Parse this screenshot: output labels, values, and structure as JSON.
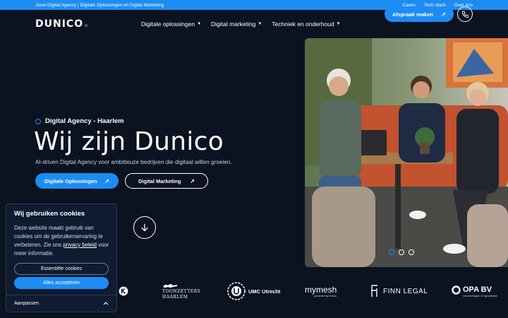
{
  "topbar": {
    "tagline": "Jouw Digital Agency | Digitale Oplossingen en Digital Marketing",
    "links": [
      "Cases",
      "Tech stack",
      "Over ons"
    ]
  },
  "header": {
    "logo": "DUNICO",
    "nav": [
      "Digitale oplossingen",
      "Digital marketing",
      "Techniek en onderhoud"
    ],
    "cta_label": "Afspraak maken"
  },
  "hero": {
    "eyebrow": "Digital Agency - Haarlem",
    "title": "Wij zijn Dunico",
    "subtitle": "AI-driven Digital Agency voor ambitieuze bedrijven die digitaal willen groeien.",
    "primary_button": "Digitale Oplossingen",
    "secondary_button": "Digital Marketing"
  },
  "carousel": {
    "count": 3,
    "active_index": 0
  },
  "clients": {
    "logos": [
      "TOONZETTERS",
      "HAARLEM",
      "UMC Utrecht",
      "mymesh",
      "powered by simac",
      "FINN LEGAL",
      "OPA BV",
      "Verzekeringen & Hypotheken"
    ]
  },
  "cookie": {
    "title": "Wij gebruiken cookies",
    "text_before": "Deze website maakt gebruik van cookies om de gebruikerservaring te verbeteren. Zie ons ",
    "link": "privacy beleid",
    "text_after": " voor meer informatie.",
    "essential_button": "Essentiële cookies",
    "accept_button": "Alles accepteren",
    "customize_label": "Aanpassen"
  },
  "colors": {
    "background": "#0b1220",
    "accent": "#1d8cf2",
    "panel": "#0f1b30"
  }
}
